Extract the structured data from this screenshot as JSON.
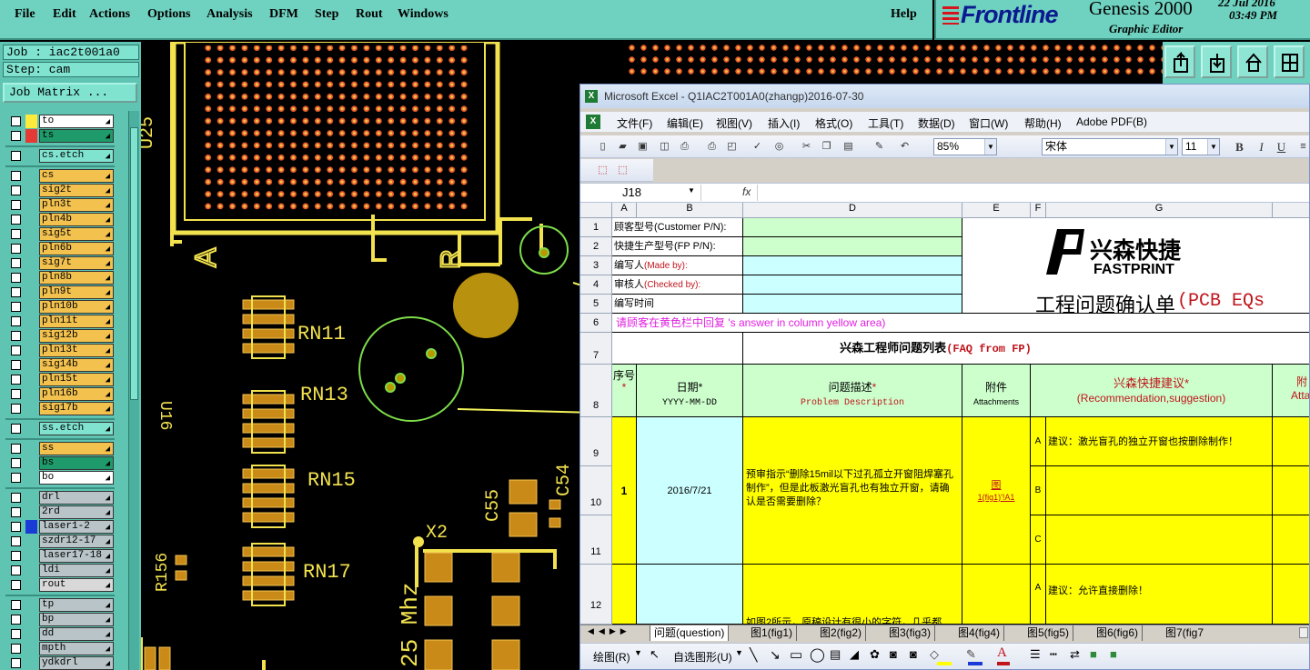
{
  "genesis": {
    "menu": [
      "File",
      "Edit",
      "Actions",
      "Options",
      "Analysis",
      "DFM",
      "Step",
      "Rout",
      "Windows"
    ],
    "help": "Help",
    "brand": "Frontline",
    "product": "Genesis 2000",
    "subtitle": "Graphic Editor",
    "date": "22 Jul 2016",
    "time": "03:49 PM",
    "job_label": "Job : iac2t001a0",
    "step_label": "Step: cam",
    "job_matrix_label": "Job Matrix ...",
    "layers": [
      {
        "name": "to",
        "color": "#ffffff",
        "swatch": "#ffeb3b"
      },
      {
        "name": "ts",
        "color": "#1f9a6a",
        "swatch": "#e53935"
      },
      {
        "name": "cs.etch",
        "color": "#7fe3d0",
        "swatch": ""
      },
      {
        "name": "cs",
        "color": "#f2c14e",
        "swatch": ""
      },
      {
        "name": "sig2t",
        "color": "#f2c14e",
        "swatch": ""
      },
      {
        "name": "pln3t",
        "color": "#f2c14e",
        "swatch": ""
      },
      {
        "name": "pln4b",
        "color": "#f2c14e",
        "swatch": ""
      },
      {
        "name": "sig5t",
        "color": "#f2c14e",
        "swatch": ""
      },
      {
        "name": "pln6b",
        "color": "#f2c14e",
        "swatch": ""
      },
      {
        "name": "sig7t",
        "color": "#f2c14e",
        "swatch": ""
      },
      {
        "name": "pln8b",
        "color": "#f2c14e",
        "swatch": ""
      },
      {
        "name": "pln9t",
        "color": "#f2c14e",
        "swatch": ""
      },
      {
        "name": "pln10b",
        "color": "#f2c14e",
        "swatch": ""
      },
      {
        "name": "pln11t",
        "color": "#f2c14e",
        "swatch": ""
      },
      {
        "name": "sig12b",
        "color": "#f2c14e",
        "swatch": ""
      },
      {
        "name": "pln13t",
        "color": "#f2c14e",
        "swatch": ""
      },
      {
        "name": "sig14b",
        "color": "#f2c14e",
        "swatch": ""
      },
      {
        "name": "pln15t",
        "color": "#f2c14e",
        "swatch": ""
      },
      {
        "name": "pln16b",
        "color": "#f2c14e",
        "swatch": ""
      },
      {
        "name": "sig17b",
        "color": "#f2c14e",
        "swatch": ""
      },
      {
        "name": "ss.etch",
        "color": "#7fe3d0",
        "swatch": ""
      },
      {
        "name": "ss",
        "color": "#f2c14e",
        "swatch": ""
      },
      {
        "name": "bs",
        "color": "#1f9a6a",
        "swatch": ""
      },
      {
        "name": "bo",
        "color": "#ffffff",
        "swatch": ""
      },
      {
        "name": "drl",
        "color": "#b8c4c8",
        "swatch": ""
      },
      {
        "name": "2rd",
        "color": "#b8c4c8",
        "swatch": ""
      },
      {
        "name": "laser1-2",
        "color": "#b8c4c8",
        "swatch": "#1b3bd6"
      },
      {
        "name": "szdr12-17",
        "color": "#b8c4c8",
        "swatch": ""
      },
      {
        "name": "laser17-18",
        "color": "#b8c4c8",
        "swatch": ""
      },
      {
        "name": "ldi",
        "color": "#b8c4c8",
        "swatch": ""
      },
      {
        "name": "rout",
        "color": "#d8d8d8",
        "swatch": ""
      },
      {
        "name": "tp",
        "color": "#b8c4c8",
        "swatch": ""
      },
      {
        "name": "bp",
        "color": "#b8c4c8",
        "swatch": ""
      },
      {
        "name": "dd",
        "color": "#b8c4c8",
        "swatch": ""
      },
      {
        "name": "mpth",
        "color": "#b8c4c8",
        "swatch": ""
      },
      {
        "name": "ydkdrl",
        "color": "#b8c4c8",
        "swatch": ""
      }
    ],
    "pcb_labels": {
      "u25": "U25",
      "u16": "U16",
      "a": "A",
      "r": "R",
      "rn11": "RN11",
      "rn13": "RN13",
      "rn15": "RN15",
      "rn17": "RN17",
      "c55": "C55",
      "c54": "C54",
      "x2": "X2",
      "r156": "R156",
      "mhz": "25 Mhz"
    }
  },
  "excel": {
    "title": "Microsoft Excel - Q1IAC2T001A0(zhangp)2016-07-30",
    "menu": [
      "文件(F)",
      "编辑(E)",
      "视图(V)",
      "插入(I)",
      "格式(O)",
      "工具(T)",
      "数据(D)",
      "窗口(W)",
      "帮助(H)",
      "Adobe PDF(B)"
    ],
    "zoom": "85%",
    "font_name": "宋体",
    "font_size": "11",
    "name_box": "J18",
    "fx": "fx",
    "columns": [
      "A",
      "B",
      "D",
      "E",
      "F",
      "G"
    ],
    "rows": [
      "1",
      "2",
      "3",
      "4",
      "5",
      "6",
      "7",
      "8",
      "9",
      "10",
      "11",
      "12"
    ],
    "customer_pn": "顾客型号(Customer P/N):",
    "fp_pn": "快捷生产型号(FP P/N):",
    "made_by_cn": "编写人",
    "made_by_en": "(Made by):",
    "checked_by_cn": "审核人",
    "checked_by_en": "(Checked by):",
    "write_time": "编写时间",
    "brand_cn": "兴森快捷",
    "brand_en": "FASTPRINT",
    "doc_title_cn": "工程问题确认单",
    "doc_title_en": "(PCB EQs",
    "yellow_note": "请顾客在黄色栏中回复 's answer in column yellow area)",
    "faq_cn": "兴森工程师问题列表",
    "faq_en": "(FAQ from FP)",
    "h_seq": "序号",
    "h_date": "日期",
    "h_date_fmt": "YYYY-MM-DD",
    "h_desc_cn": "问题描述",
    "h_desc_en": "Problem Description",
    "h_attach_cn": "附件",
    "h_attach_en": "Attachments",
    "h_rec_cn": "兴森快捷建议",
    "h_rec_en": "(Recommendation,suggestion)",
    "h_attach2_cn": "附",
    "h_attach2_en": "Atta",
    "star": "*",
    "q1_no": "1",
    "q1_date": "2016/7/21",
    "q1_desc": "预审指示“删除15mil以下过孔孤立开窗阻焊塞孔制作”，但是此板激光盲孔也有独立开窗，请确认是否需要删除？",
    "q1_attach_cn": "图",
    "q1_attach_link": "1(fig1)'!A1",
    "opt_a": "A",
    "opt_b": "B",
    "opt_c": "C",
    "q1_suggest_a": "建议：激光盲孔的独立开窗也按删除制作！",
    "q2_suggest_a": "建议：允许直接删除！",
    "q2_desc_partial": "如图2所示，原稿设计有很小的字符，几乎都",
    "sheets": [
      "问题(question)",
      "图1(fig1)",
      "图2(fig2)",
      "图3(fig3)",
      "图4(fig4)",
      "图5(fig5)",
      "图6(fig6)",
      "图7(fig7"
    ],
    "draw_label": "绘图(R)",
    "autoshape_label": "自选图形(U)"
  }
}
